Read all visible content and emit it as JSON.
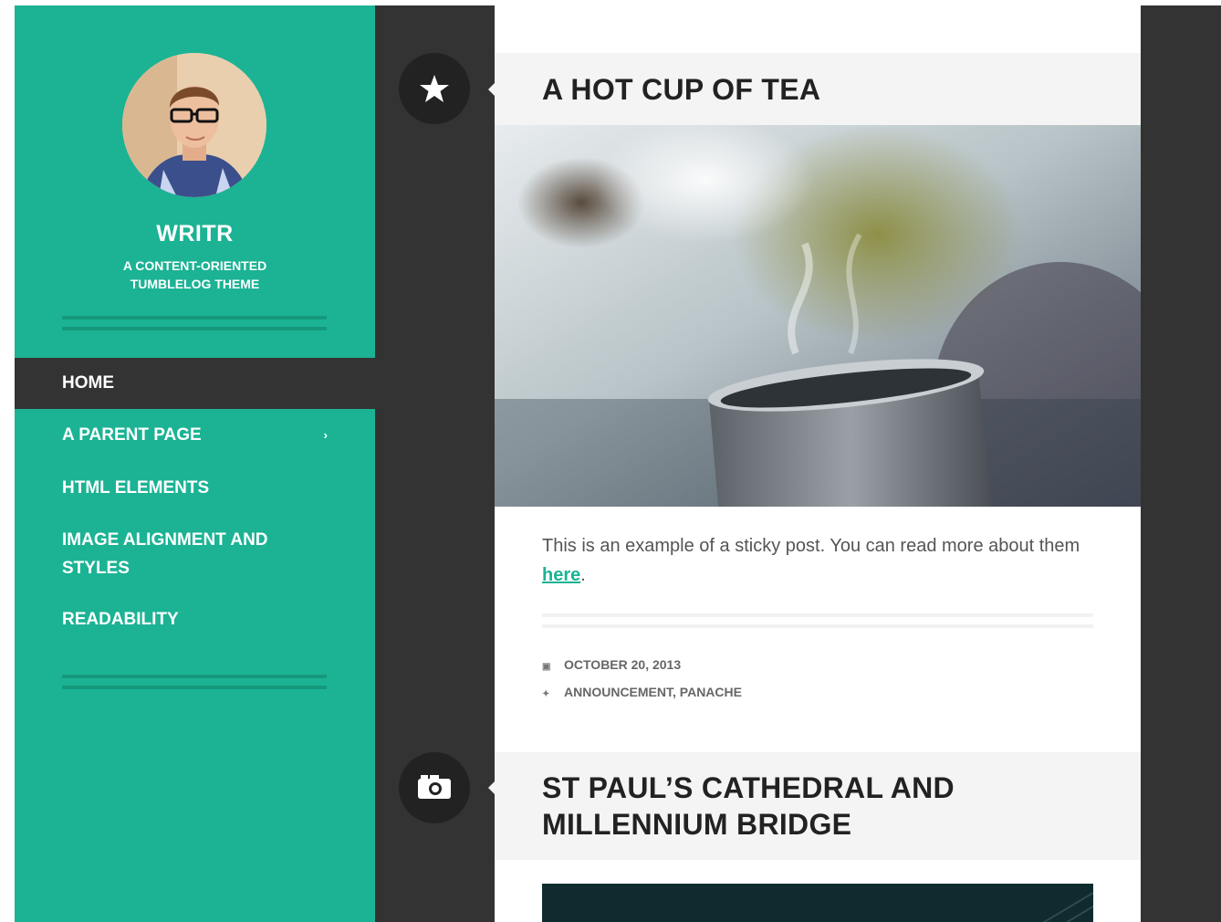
{
  "colors": {
    "accent": "#1bb394",
    "dark": "#333333",
    "header_bg": "#f4f4f4"
  },
  "sidebar": {
    "site_title": "WRITR",
    "site_description_line1": "A CONTENT-ORIENTED",
    "site_description_line2": "TUMBLELOG THEME",
    "avatar_icon": "profile-photo",
    "nav": [
      {
        "label": "HOME",
        "active": true
      },
      {
        "label": "A PARENT PAGE",
        "has_children": true,
        "caret": "›"
      },
      {
        "label": "HTML ELEMENTS"
      },
      {
        "label_line1": "IMAGE ALIGNMENT AND",
        "label_line2": "STYLES"
      },
      {
        "label": "READABILITY"
      }
    ]
  },
  "posts": [
    {
      "type_icon": "star-icon",
      "title": "A HOT CUP OF TEA",
      "excerpt_text": "This is an example of a sticky post. You can read more about them ",
      "excerpt_link": "here",
      "excerpt_end": ".",
      "date_icon": "calendar-icon",
      "date": "OCTOBER 20, 2013",
      "tags_icon": "tag-icon",
      "tags": "ANNOUNCEMENT, PANACHE"
    },
    {
      "type_icon": "camera-icon",
      "title_line1": "ST PAUL’S CATHEDRAL AND",
      "title_line2": "MILLENNIUM BRIDGE"
    }
  ]
}
